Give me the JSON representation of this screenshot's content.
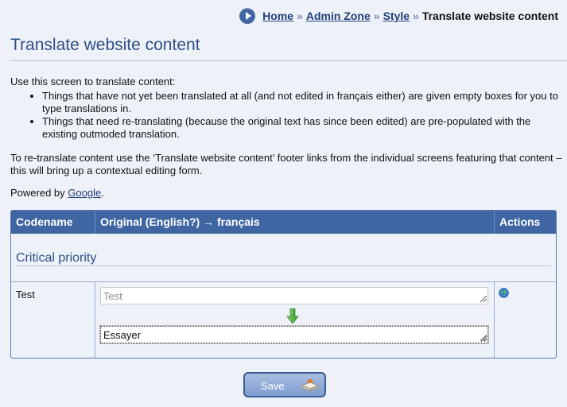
{
  "breadcrumb": {
    "items": [
      {
        "label": "Home"
      },
      {
        "label": "Admin Zone"
      },
      {
        "label": "Style"
      }
    ],
    "separator": "»",
    "current": "Translate website content"
  },
  "page": {
    "title": "Translate website content"
  },
  "intro": {
    "lead": "Use this screen to translate content:",
    "bullets": [
      "Things that have not yet been translated at all (and not edited in français either) are given empty boxes for you to type translations in.",
      "Things that need re-translating (because the original text has since been edited) are pre-populated with the existing outmoded translation."
    ],
    "paragraph": "To re-translate content use the ‘Translate website content’ footer links from the individual screens featuring that content – this will bring up a contextual editing form.",
    "powered_prefix": "Powered by ",
    "powered_link": "Google",
    "powered_suffix": "."
  },
  "table": {
    "headers": {
      "codename": "Codename",
      "original": "Original (English?) → français",
      "actions": "Actions"
    },
    "section_title": "Critical priority",
    "rows": [
      {
        "codename": "Test",
        "original_value": "Test",
        "translation_value": "Essayer",
        "action_icon": "globe-icon"
      }
    ]
  },
  "form": {
    "save_label": "Save",
    "save_icon": "save-disk-icon"
  },
  "colors": {
    "accent": "#3f66a3",
    "title": "#2e4f86",
    "background": "#eef2f8",
    "link": "#1f3f7a"
  }
}
